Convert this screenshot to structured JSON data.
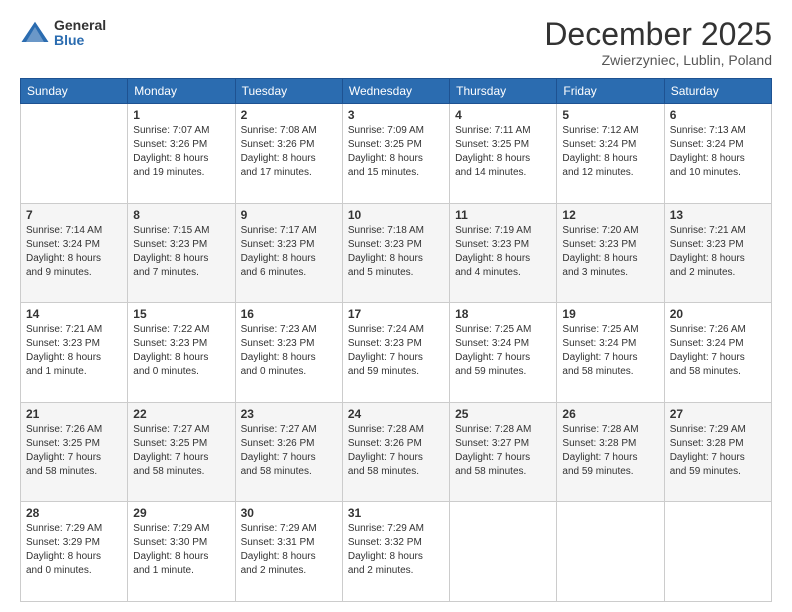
{
  "header": {
    "logo_general": "General",
    "logo_blue": "Blue",
    "month_title": "December 2025",
    "location": "Zwierzyniec, Lublin, Poland"
  },
  "days_of_week": [
    "Sunday",
    "Monday",
    "Tuesday",
    "Wednesday",
    "Thursday",
    "Friday",
    "Saturday"
  ],
  "weeks": [
    [
      {
        "day": "",
        "info": ""
      },
      {
        "day": "1",
        "info": "Sunrise: 7:07 AM\nSunset: 3:26 PM\nDaylight: 8 hours\nand 19 minutes."
      },
      {
        "day": "2",
        "info": "Sunrise: 7:08 AM\nSunset: 3:26 PM\nDaylight: 8 hours\nand 17 minutes."
      },
      {
        "day": "3",
        "info": "Sunrise: 7:09 AM\nSunset: 3:25 PM\nDaylight: 8 hours\nand 15 minutes."
      },
      {
        "day": "4",
        "info": "Sunrise: 7:11 AM\nSunset: 3:25 PM\nDaylight: 8 hours\nand 14 minutes."
      },
      {
        "day": "5",
        "info": "Sunrise: 7:12 AM\nSunset: 3:24 PM\nDaylight: 8 hours\nand 12 minutes."
      },
      {
        "day": "6",
        "info": "Sunrise: 7:13 AM\nSunset: 3:24 PM\nDaylight: 8 hours\nand 10 minutes."
      }
    ],
    [
      {
        "day": "7",
        "info": "Sunrise: 7:14 AM\nSunset: 3:24 PM\nDaylight: 8 hours\nand 9 minutes."
      },
      {
        "day": "8",
        "info": "Sunrise: 7:15 AM\nSunset: 3:23 PM\nDaylight: 8 hours\nand 7 minutes."
      },
      {
        "day": "9",
        "info": "Sunrise: 7:17 AM\nSunset: 3:23 PM\nDaylight: 8 hours\nand 6 minutes."
      },
      {
        "day": "10",
        "info": "Sunrise: 7:18 AM\nSunset: 3:23 PM\nDaylight: 8 hours\nand 5 minutes."
      },
      {
        "day": "11",
        "info": "Sunrise: 7:19 AM\nSunset: 3:23 PM\nDaylight: 8 hours\nand 4 minutes."
      },
      {
        "day": "12",
        "info": "Sunrise: 7:20 AM\nSunset: 3:23 PM\nDaylight: 8 hours\nand 3 minutes."
      },
      {
        "day": "13",
        "info": "Sunrise: 7:21 AM\nSunset: 3:23 PM\nDaylight: 8 hours\nand 2 minutes."
      }
    ],
    [
      {
        "day": "14",
        "info": "Sunrise: 7:21 AM\nSunset: 3:23 PM\nDaylight: 8 hours\nand 1 minute."
      },
      {
        "day": "15",
        "info": "Sunrise: 7:22 AM\nSunset: 3:23 PM\nDaylight: 8 hours\nand 0 minutes."
      },
      {
        "day": "16",
        "info": "Sunrise: 7:23 AM\nSunset: 3:23 PM\nDaylight: 8 hours\nand 0 minutes."
      },
      {
        "day": "17",
        "info": "Sunrise: 7:24 AM\nSunset: 3:23 PM\nDaylight: 7 hours\nand 59 minutes."
      },
      {
        "day": "18",
        "info": "Sunrise: 7:25 AM\nSunset: 3:24 PM\nDaylight: 7 hours\nand 59 minutes."
      },
      {
        "day": "19",
        "info": "Sunrise: 7:25 AM\nSunset: 3:24 PM\nDaylight: 7 hours\nand 58 minutes."
      },
      {
        "day": "20",
        "info": "Sunrise: 7:26 AM\nSunset: 3:24 PM\nDaylight: 7 hours\nand 58 minutes."
      }
    ],
    [
      {
        "day": "21",
        "info": "Sunrise: 7:26 AM\nSunset: 3:25 PM\nDaylight: 7 hours\nand 58 minutes."
      },
      {
        "day": "22",
        "info": "Sunrise: 7:27 AM\nSunset: 3:25 PM\nDaylight: 7 hours\nand 58 minutes."
      },
      {
        "day": "23",
        "info": "Sunrise: 7:27 AM\nSunset: 3:26 PM\nDaylight: 7 hours\nand 58 minutes."
      },
      {
        "day": "24",
        "info": "Sunrise: 7:28 AM\nSunset: 3:26 PM\nDaylight: 7 hours\nand 58 minutes."
      },
      {
        "day": "25",
        "info": "Sunrise: 7:28 AM\nSunset: 3:27 PM\nDaylight: 7 hours\nand 58 minutes."
      },
      {
        "day": "26",
        "info": "Sunrise: 7:28 AM\nSunset: 3:28 PM\nDaylight: 7 hours\nand 59 minutes."
      },
      {
        "day": "27",
        "info": "Sunrise: 7:29 AM\nSunset: 3:28 PM\nDaylight: 7 hours\nand 59 minutes."
      }
    ],
    [
      {
        "day": "28",
        "info": "Sunrise: 7:29 AM\nSunset: 3:29 PM\nDaylight: 8 hours\nand 0 minutes."
      },
      {
        "day": "29",
        "info": "Sunrise: 7:29 AM\nSunset: 3:30 PM\nDaylight: 8 hours\nand 1 minute."
      },
      {
        "day": "30",
        "info": "Sunrise: 7:29 AM\nSunset: 3:31 PM\nDaylight: 8 hours\nand 2 minutes."
      },
      {
        "day": "31",
        "info": "Sunrise: 7:29 AM\nSunset: 3:32 PM\nDaylight: 8 hours\nand 2 minutes."
      },
      {
        "day": "",
        "info": ""
      },
      {
        "day": "",
        "info": ""
      },
      {
        "day": "",
        "info": ""
      }
    ]
  ]
}
